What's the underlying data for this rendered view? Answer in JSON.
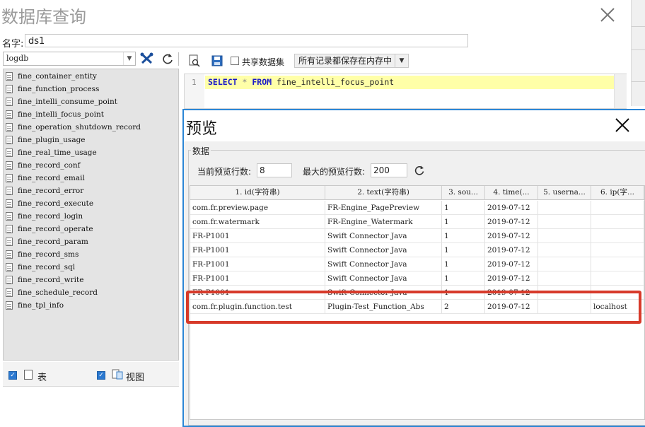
{
  "main": {
    "title": "数据库查询",
    "name_label": "名字:",
    "name_value": "ds1"
  },
  "left_panel": {
    "database": "logdb",
    "tables": [
      "fine_container_entity",
      "fine_function_process",
      "fine_intelli_consume_point",
      "fine_intelli_focus_point",
      "fine_operation_shutdown_record",
      "fine_plugin_usage",
      "fine_real_time_usage",
      "fine_record_conf",
      "fine_record_email",
      "fine_record_error",
      "fine_record_execute",
      "fine_record_login",
      "fine_record_operate",
      "fine_record_param",
      "fine_record_sms",
      "fine_record_sql",
      "fine_record_write",
      "fine_schedule_record",
      "fine_tpl_info"
    ],
    "show_tables_label": "表",
    "show_views_label": "视图"
  },
  "toolbar": {
    "share_label": "共享数据集",
    "memory_option": "所有记录都保存在内存中"
  },
  "editor": {
    "line_number": "1",
    "kw_select": "SELECT",
    "star": "*",
    "kw_from": "FROM",
    "table_name": "fine_intelli_focus_point"
  },
  "preview": {
    "title": "预览",
    "group_label": "数据",
    "current_rows_label": "当前预览行数:",
    "current_rows_value": "8",
    "max_rows_label": "最大的预览行数:",
    "max_rows_value": "200",
    "columns": [
      "1. id(字符串)",
      "2. text(字符串)",
      "3. sou...",
      "4. time(...",
      "5. userna...",
      "6. ip(字..."
    ],
    "rows": [
      [
        "com.fr.preview.page",
        "FR-Engine_PagePreview",
        "1",
        "2019-07-12",
        "",
        ""
      ],
      [
        "com.fr.watermark",
        "FR-Engine_Watermark",
        "1",
        "2019-07-12",
        "",
        ""
      ],
      [
        "FR-P1001",
        "Swift Connector Java",
        "1",
        "2019-07-12",
        "",
        ""
      ],
      [
        "FR-P1001",
        "Swift Connector Java",
        "1",
        "2019-07-12",
        "",
        ""
      ],
      [
        "FR-P1001",
        "Swift Connector Java",
        "1",
        "2019-07-12",
        "",
        ""
      ],
      [
        "FR-P1001",
        "Swift Connector Java",
        "1",
        "2019-07-12",
        "",
        ""
      ],
      [
        "FR-P1001",
        "Swift Connector Java",
        "1",
        "2019-07-12",
        "",
        ""
      ],
      [
        "com.fr.plugin.function.test",
        "Plugin-Test_Function_Abs",
        "2",
        "2019-07-12",
        "",
        "localhost"
      ]
    ]
  },
  "colors": {
    "accent": "#2b86d6",
    "highlight": "#d73a2a",
    "sql_line_bg": "#ffffa8"
  }
}
